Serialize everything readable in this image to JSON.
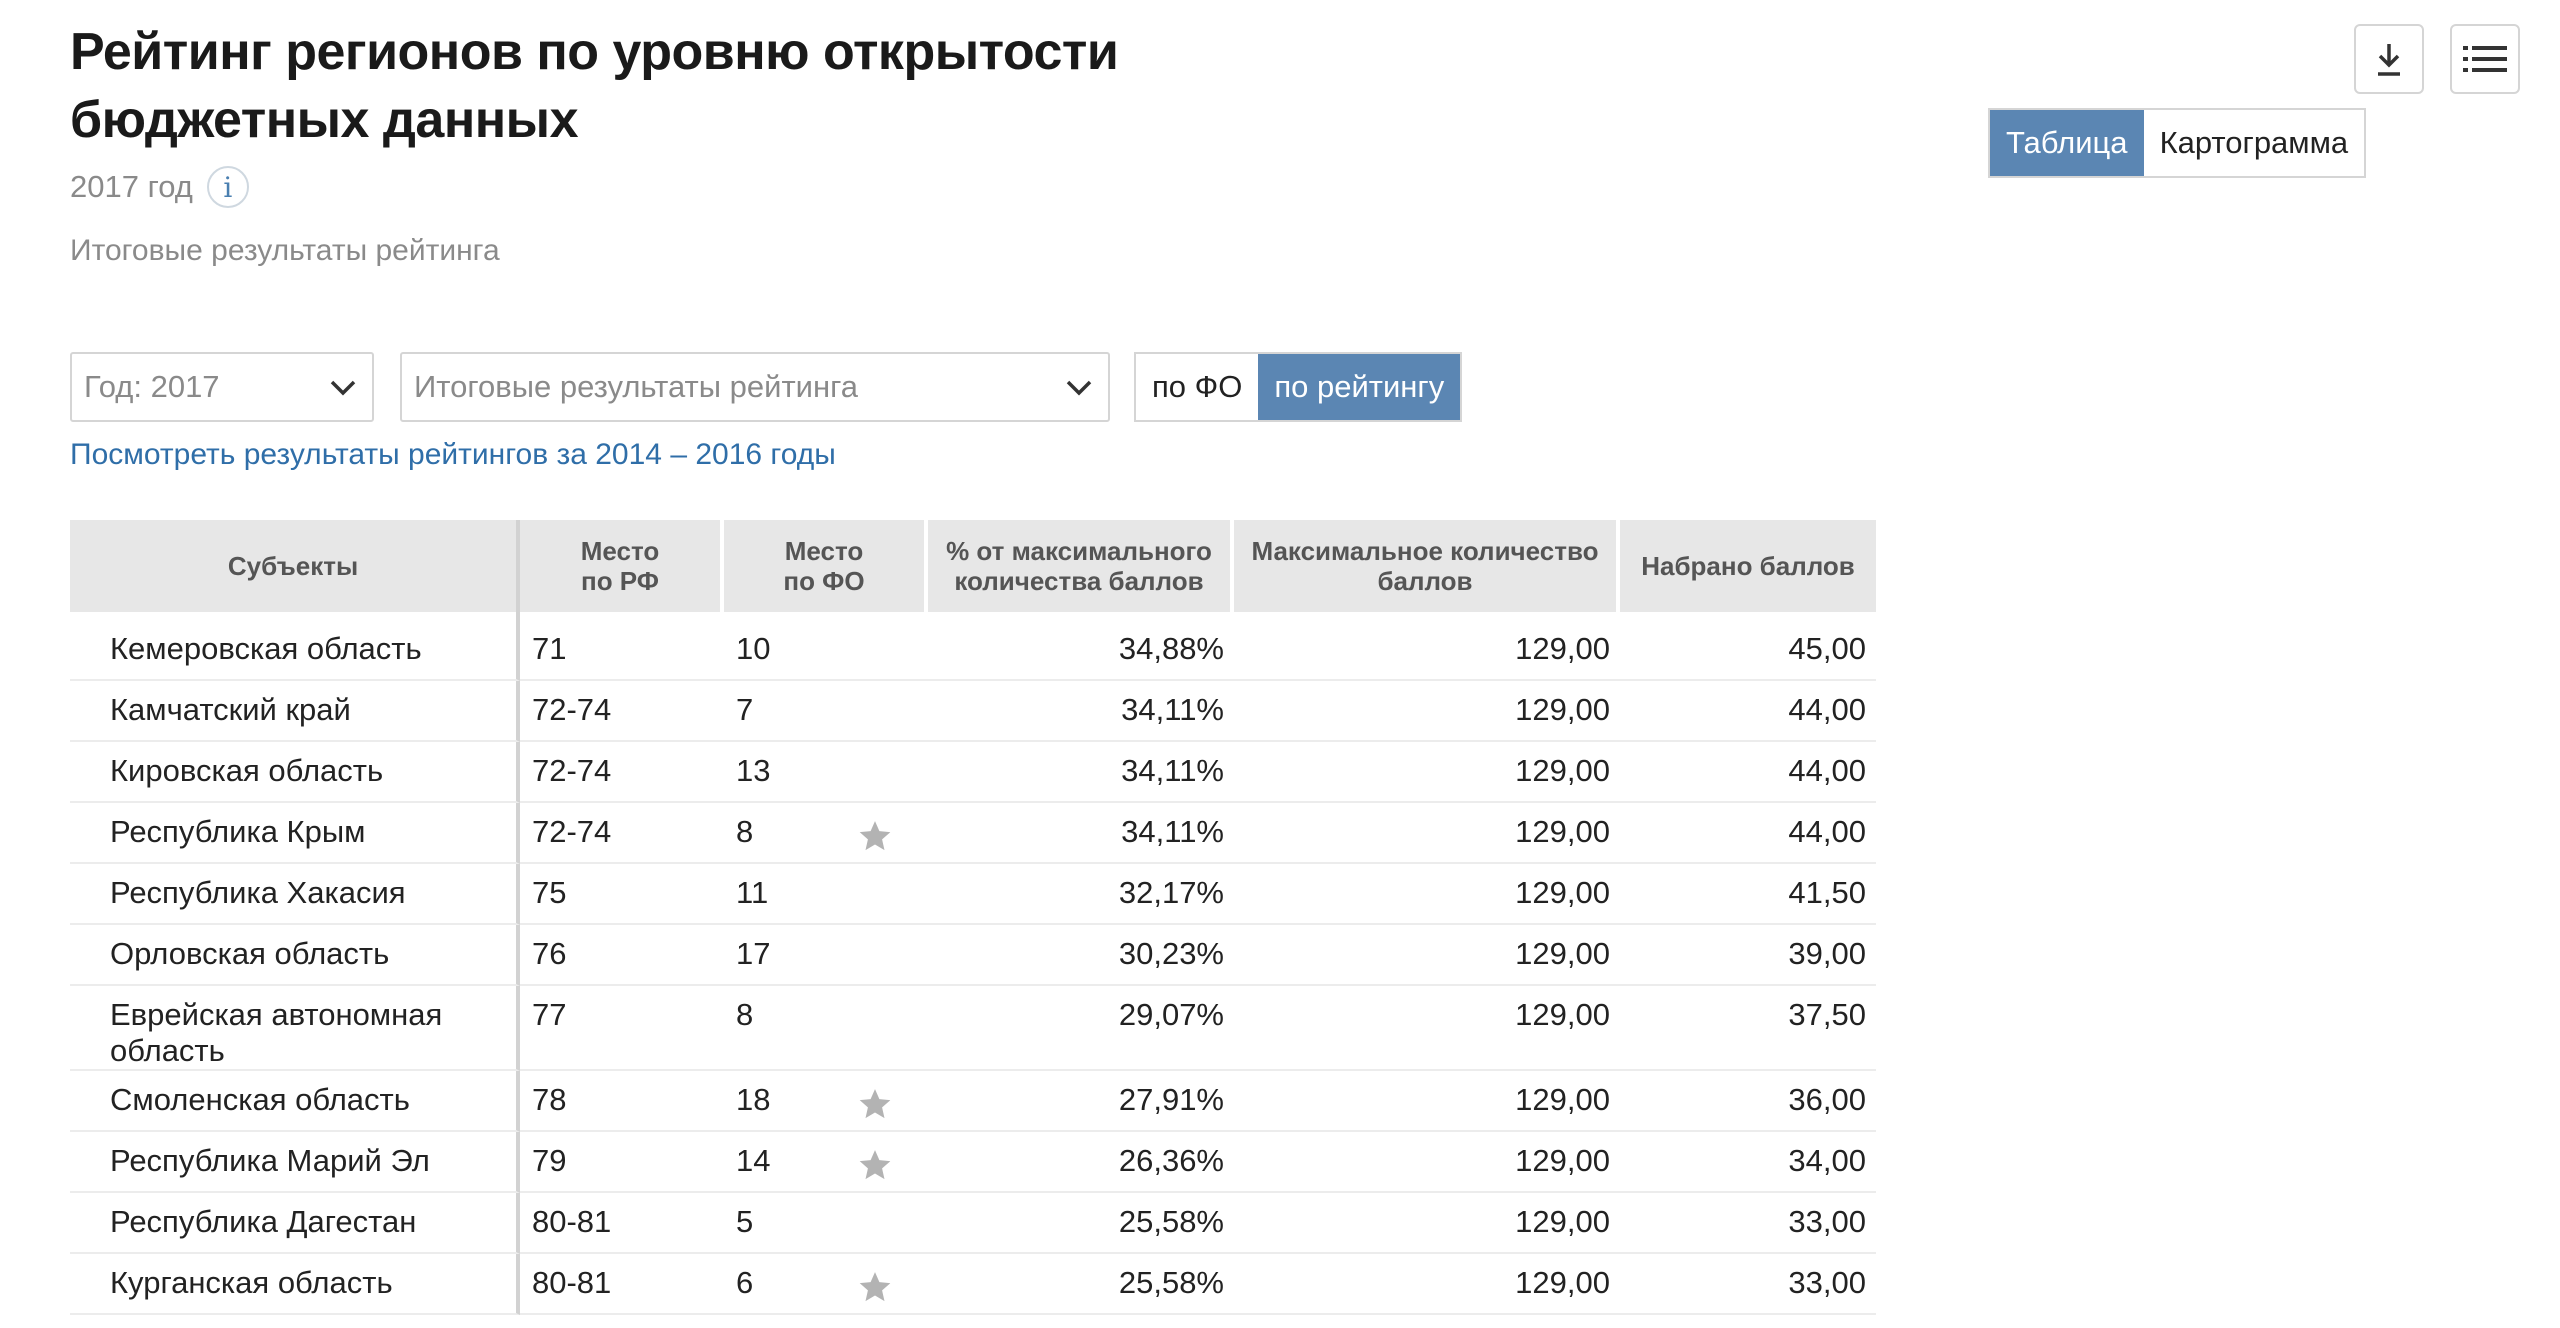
{
  "header": {
    "title": "Рейтинг регионов по уровню открытости бюджетных данных",
    "year_label": "2017 год",
    "info_icon": "info-icon",
    "subtitle": "Итоговые результаты рейтинга"
  },
  "toolbar": {
    "download_icon": "download-icon",
    "list_icon": "list-icon",
    "view_toggle": [
      {
        "label": "Таблица",
        "active": true
      },
      {
        "label": "Картограмма",
        "active": false
      }
    ]
  },
  "filters": {
    "year_select": "Год: 2017",
    "results_select": "Итоговые результаты рейтинга",
    "group_toggle": [
      {
        "label": "по ФО",
        "active": false
      },
      {
        "label": "по рейтингу",
        "active": true
      }
    ],
    "history_link": "Посмотреть результаты рейтингов за 2014 – 2016 годы"
  },
  "colors": {
    "accent": "#5b86b3",
    "link": "#2f6ea8",
    "header_bg": "#e7e7e7",
    "star": "#b3b3b3"
  },
  "table": {
    "columns": {
      "subject": "Субъекты",
      "place_rf": "Место\nпо РФ",
      "place_fo": "Место\nпо ФО",
      "percent": "% от максимального количества баллов",
      "max_points": "Максимальное количество баллов",
      "points": "Набрано баллов"
    },
    "rows": [
      {
        "subject": "Кемеровская область",
        "place_rf": "71",
        "place_fo": "10",
        "star": false,
        "percent": "34,88%",
        "max_points": "129,00",
        "points": "45,00"
      },
      {
        "subject": "Камчатский край",
        "place_rf": "72-74",
        "place_fo": "7",
        "star": false,
        "percent": "34,11%",
        "max_points": "129,00",
        "points": "44,00"
      },
      {
        "subject": "Кировская область",
        "place_rf": "72-74",
        "place_fo": "13",
        "star": false,
        "percent": "34,11%",
        "max_points": "129,00",
        "points": "44,00"
      },
      {
        "subject": "Республика Крым",
        "place_rf": "72-74",
        "place_fo": "8",
        "star": true,
        "percent": "34,11%",
        "max_points": "129,00",
        "points": "44,00"
      },
      {
        "subject": "Республика Хакасия",
        "place_rf": "75",
        "place_fo": "11",
        "star": false,
        "percent": "32,17%",
        "max_points": "129,00",
        "points": "41,50"
      },
      {
        "subject": "Орловская область",
        "place_rf": "76",
        "place_fo": "17",
        "star": false,
        "percent": "30,23%",
        "max_points": "129,00",
        "points": "39,00"
      },
      {
        "subject": "Еврейская автономная область",
        "place_rf": "77",
        "place_fo": "8",
        "star": false,
        "percent": "29,07%",
        "max_points": "129,00",
        "points": "37,50"
      },
      {
        "subject": "Смоленская область",
        "place_rf": "78",
        "place_fo": "18",
        "star": true,
        "percent": "27,91%",
        "max_points": "129,00",
        "points": "36,00"
      },
      {
        "subject": "Республика Марий Эл",
        "place_rf": "79",
        "place_fo": "14",
        "star": true,
        "percent": "26,36%",
        "max_points": "129,00",
        "points": "34,00"
      },
      {
        "subject": "Республика Дагестан",
        "place_rf": "80-81",
        "place_fo": "5",
        "star": false,
        "percent": "25,58%",
        "max_points": "129,00",
        "points": "33,00"
      },
      {
        "subject": "Курганская область",
        "place_rf": "80-81",
        "place_fo": "6",
        "star": true,
        "percent": "25,58%",
        "max_points": "129,00",
        "points": "33,00"
      }
    ]
  }
}
